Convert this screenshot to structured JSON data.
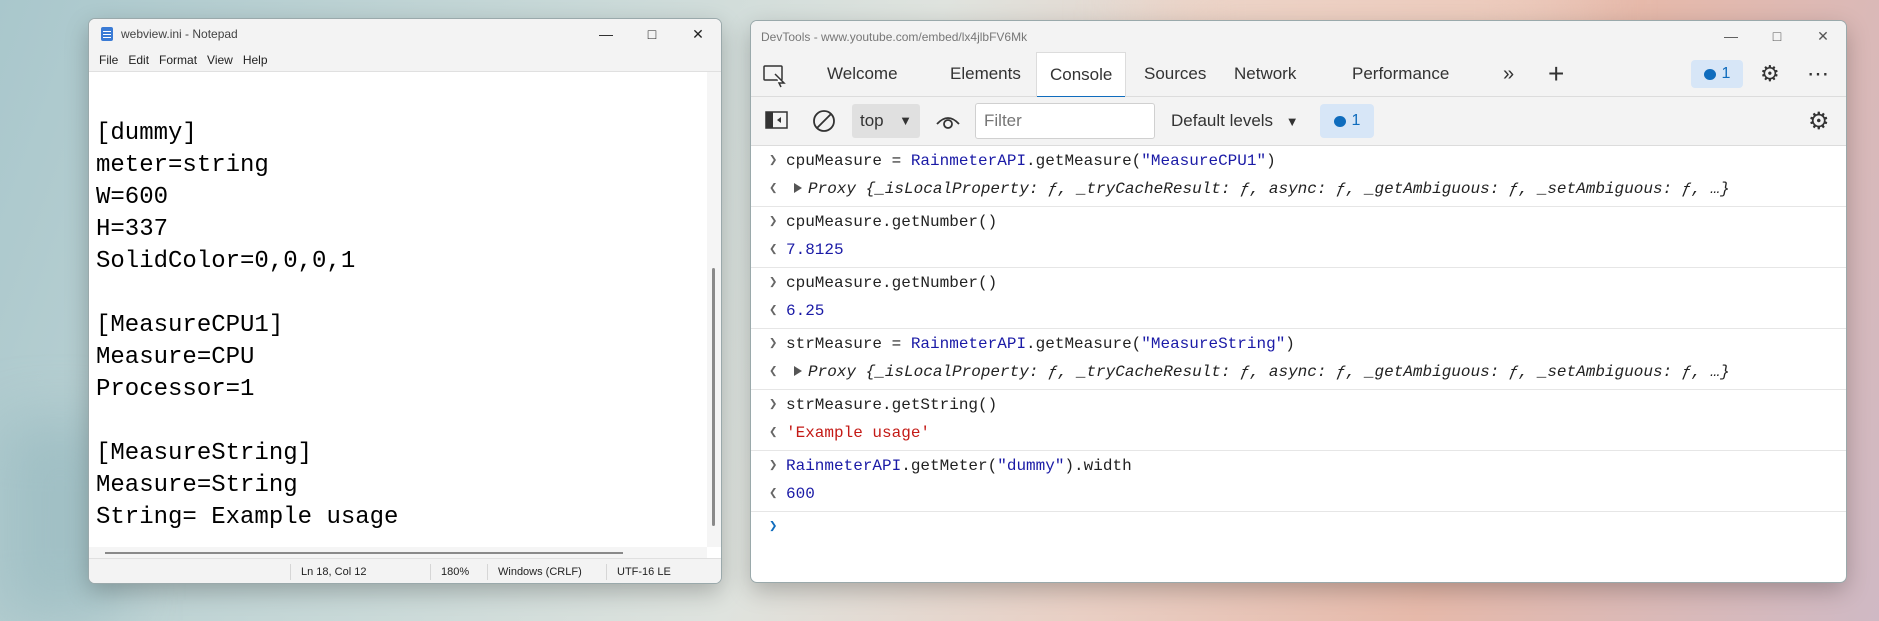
{
  "notepad": {
    "title": "webview.ini - Notepad",
    "menu": [
      "File",
      "Edit",
      "Format",
      "View",
      "Help"
    ],
    "content": "[dummy]\nmeter=string\nW=600\nH=337\nSolidColor=0,0,0,1\n\n[MeasureCPU1]\nMeasure=CPU\nProcessor=1\n\n[MeasureString]\nMeasure=String\nString= Example usage",
    "status": {
      "position": "Ln 18, Col 12",
      "zoom": "180%",
      "line_ending": "Windows (CRLF)",
      "encoding": "UTF-16 LE"
    }
  },
  "devtools": {
    "title": "DevTools - www.youtube.com/embed/lx4jlbFV6Mk",
    "tabs": [
      "Welcome",
      "Elements",
      "Console",
      "Sources",
      "Network",
      "Performance"
    ],
    "active_tab": "Console",
    "issues_count": "1",
    "context": "top",
    "filter_placeholder": "Filter",
    "levels": "Default levels",
    "messages_count": "1",
    "console": [
      {
        "input": [
          "cpuMeasure",
          " = ",
          "RainmeterAPI",
          ".getMeasure(",
          "\"MeasureCPU1\"",
          ")"
        ],
        "output": "Proxy {_isLocalProperty: ƒ, _tryCacheResult: ƒ, async: ƒ, _getAmbiguous: ƒ, _setAmbiguous: ƒ, …}",
        "output_type": "object"
      },
      {
        "input": [
          "cpuMeasure",
          ".getNumber()",
          "",
          "",
          "",
          ""
        ],
        "output": "7.8125",
        "output_type": "number"
      },
      {
        "input": [
          "cpuMeasure",
          ".getNumber()",
          "",
          "",
          "",
          ""
        ],
        "output": "6.25",
        "output_type": "number"
      },
      {
        "input": [
          "strMeasure",
          " = ",
          "RainmeterAPI",
          ".getMeasure(",
          "\"MeasureString\"",
          ")"
        ],
        "output": "Proxy {_isLocalProperty: ƒ, _tryCacheResult: ƒ, async: ƒ, _getAmbiguous: ƒ, _setAmbiguous: ƒ, …}",
        "output_type": "object"
      },
      {
        "input": [
          "strMeasure",
          ".getString()",
          "",
          "",
          "",
          ""
        ],
        "output": "'Example usage'",
        "output_type": "string"
      },
      {
        "input": [
          "RainmeterAPI",
          ".getMeter(",
          "\"dummy\"",
          ").width",
          "",
          ""
        ],
        "output": "600",
        "output_type": "number"
      }
    ]
  }
}
